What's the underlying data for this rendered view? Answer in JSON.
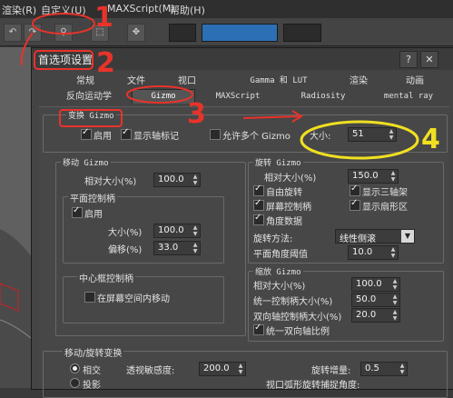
{
  "menubar": {
    "items": [
      "渲染(R)",
      "自定义(U)",
      "MAXScript(M)",
      "帮助(H)"
    ]
  },
  "toolbar": {
    "icon_names": [
      "undo-icon",
      "redo-icon",
      "link-icon",
      "select-icon",
      "move-icon"
    ]
  },
  "dialog": {
    "title": "首选项设置",
    "tabs_row1": [
      "常规",
      "文件",
      "视口",
      "Gamma 和 LUT",
      "渲染",
      "动画"
    ],
    "tabs_row2": [
      "反向运动学",
      "Gizmo",
      "MAXScript",
      "Radiosity",
      "mental ray"
    ],
    "active_tab": "Gizmo"
  },
  "transform_gizmo": {
    "legend": "变换 Gizmo",
    "enable_label": "启用",
    "enable": true,
    "show_axis_label": "显示轴标记",
    "show_axis": true,
    "allow_multi_label": "允许多个 Gizmo",
    "allow_multi": false,
    "size_label": "大小:",
    "size_value": "51"
  },
  "move_gizmo": {
    "legend": "移动 Gizmo",
    "relative_size_label": "相对大小(%)",
    "relative_size": "100.0",
    "plane_handle_legend": "平面控制柄",
    "plane_enable_label": "启用",
    "plane_enable": true,
    "plane_size_label": "大小(%)",
    "plane_size": "100.0",
    "offset_label": "偏移(%)",
    "offset": "33.0",
    "center_handle_legend": "中心框控制柄",
    "center_screen_move_label": "在屏幕空间内移动",
    "center_screen_move": false
  },
  "rotate_gizmo": {
    "legend": "旋转 Gizmo",
    "relative_size_label": "相对大小(%)",
    "relative_size": "150.0",
    "free_rotate_label": "自由旋转",
    "free_rotate": true,
    "show_tri_axis_label": "显示三轴架",
    "show_tri_axis": true,
    "screen_handle_label": "屏幕控制柄",
    "screen_handle": true,
    "show_sector_label": "显示扇形区",
    "show_sector": true,
    "angle_data_label": "角度数据",
    "angle_data": true,
    "rotate_method_label": "旋转方法:",
    "rotate_method": "线性侧滚",
    "plane_angle_label": "平面角度阈值",
    "plane_angle": "10.0"
  },
  "scale_gizmo": {
    "legend": "缩放 Gizmo",
    "relative_size_label": "相对大小(%)",
    "relative_size": "100.0",
    "uniform_handle_label": "统一控制柄大小(%)",
    "uniform_handle": "50.0",
    "dual_axis_label": "双向轴控制柄大小(%)",
    "dual_axis": "20.0",
    "uniform_dual_label": "统一双向轴比例",
    "uniform_dual": true
  },
  "move_rotate": {
    "legend": "移动/旋转变换",
    "radio1_label": "相交",
    "radio2_label": "投影",
    "sensitivity_label": "透视敏感度:",
    "sensitivity": "200.0",
    "rotate_increment_label": "旋转增量:",
    "rotate_increment": "0.5",
    "viewport_arc_label": "视口弧形旋转捕捉角度:"
  },
  "annotations": {
    "num1": "1",
    "num2": "2",
    "num3": "3",
    "num4": "4",
    "red_color": "#e8332a",
    "yellow_color": "#f0e020"
  }
}
